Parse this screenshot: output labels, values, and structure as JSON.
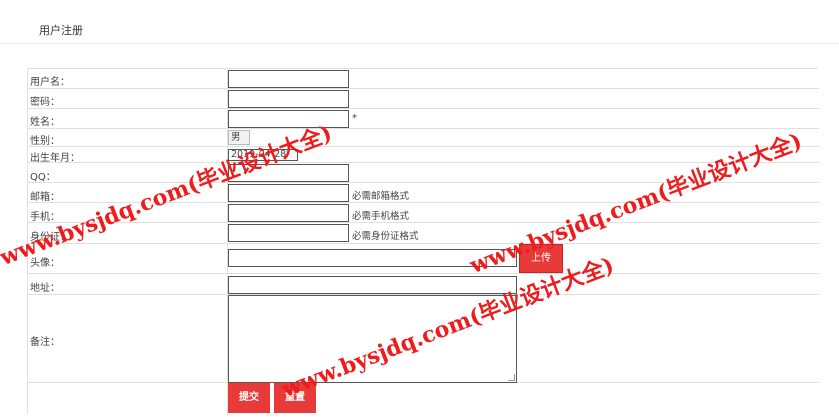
{
  "header": {
    "title": "用户注册"
  },
  "form": {
    "username": {
      "label": "用户名：",
      "value": ""
    },
    "password": {
      "label": "密码：",
      "value": ""
    },
    "name": {
      "label": "姓名：",
      "value": "",
      "required_mark": "*"
    },
    "gender": {
      "label": "性别：",
      "selected": "男"
    },
    "birthdate": {
      "label": "出生年月：",
      "value": "2019-04-28"
    },
    "qq": {
      "label": "QQ：",
      "value": ""
    },
    "email": {
      "label": "邮箱：",
      "value": "",
      "hint": "必需邮箱格式"
    },
    "phone": {
      "label": "手机：",
      "value": "",
      "hint": "必需手机格式"
    },
    "idcard": {
      "label": "身份证：",
      "value": "",
      "hint": "必需身份证格式"
    },
    "avatar": {
      "label": "头像：",
      "value": "",
      "upload_label": "上传"
    },
    "address": {
      "label": "地址：",
      "value": ""
    },
    "remark": {
      "label": "备注：",
      "value": ""
    },
    "submit_label": "提交",
    "reset_label": "重置"
  },
  "watermark": {
    "text": "www.bysjdq.com(毕业设计大全)"
  },
  "colors": {
    "accent": "#e93a3a",
    "watermark": "#ee1c1c"
  }
}
